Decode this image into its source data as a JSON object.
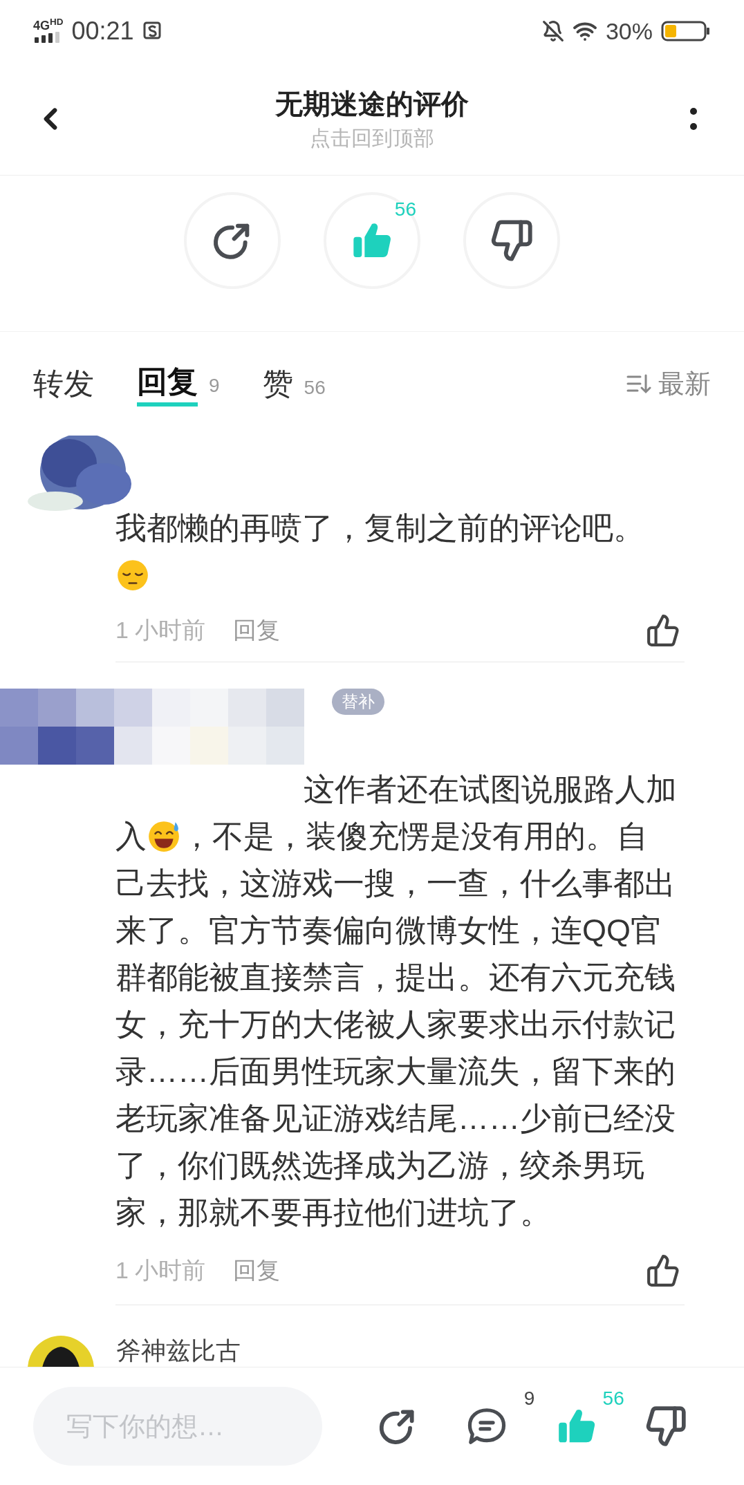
{
  "status_bar": {
    "network": "4G$^{HD}$",
    "time": "00:21",
    "battery": "30%"
  },
  "header": {
    "title": "无期迷途的评价",
    "subtitle": "点击回到顶部"
  },
  "actions": [
    {
      "kind": "share"
    },
    {
      "kind": "like",
      "count": "56",
      "selected": true
    },
    {
      "kind": "dislike",
      "selected": false
    }
  ],
  "tabs": [
    {
      "label": "转发",
      "selected": false
    },
    {
      "label": "回复",
      "count": "9",
      "selected": true
    },
    {
      "label": "赞",
      "count": "56",
      "selected": false
    }
  ],
  "sort": {
    "label": "最新"
  },
  "comments": [
    {
      "avatar": {
        "kind": "scribble"
      },
      "lines": [
        {
          "segments": [
            {
              "kind": "text",
              "text": "我都懒的再喷了，复制之前的评论吧。"
            }
          ]
        },
        {
          "segments": [
            {
              "kind": "pensive"
            }
          ]
        }
      ],
      "time": "1 小时前",
      "reply": "回复"
    },
    {
      "avatar": {
        "kind": "pixelated"
      },
      "badge": "替补",
      "lines": [
        {
          "segments": [
            {
              "kind": "text",
              "text": "这作者还在试图说服路人加"
            }
          ]
        },
        {
          "segments": [
            {
              "kind": "text",
              "text": "入"
            },
            {
              "kind": "sweatsmile"
            },
            {
              "kind": "text",
              "text": "，不是，装傻充愣是没有用的。自"
            }
          ]
        },
        {
          "segments": [
            {
              "kind": "text",
              "text": "己去找，这游戏一搜，一查，什么事都出"
            }
          ]
        },
        {
          "segments": [
            {
              "kind": "text",
              "text": "来了。官方节奏偏向微博女性，连QQ官"
            }
          ]
        },
        {
          "segments": [
            {
              "kind": "text",
              "text": "群都能被直接禁言，提出。还有六元充钱"
            }
          ]
        },
        {
          "segments": [
            {
              "kind": "text",
              "text": "女，充十万的大佬被人家要求出示付款记"
            }
          ]
        },
        {
          "segments": [
            {
              "kind": "text",
              "text": "录……后面男性玩家大量流失，留下来的"
            }
          ]
        },
        {
          "segments": [
            {
              "kind": "text",
              "text": "老玩家准备见证游戏结尾……少前已经没"
            }
          ]
        },
        {
          "segments": [
            {
              "kind": "text",
              "text": "了，你们既然选择成为乙游，绞杀男玩"
            }
          ]
        },
        {
          "segments": [
            {
              "kind": "text",
              "text": "家，那就不要再拉他们进坑了。"
            }
          ]
        }
      ],
      "time": "1 小时前",
      "reply": "回复"
    },
    {
      "avatar": {
        "kind": "figure"
      },
      "name": "斧神兹比古"
    }
  ],
  "composer": {
    "placeholder": "写下你的想…"
  },
  "bottom_actions": [
    {
      "kind": "share"
    },
    {
      "kind": "comment",
      "count": "9"
    },
    {
      "kind": "like",
      "count": "56",
      "selected": true
    },
    {
      "kind": "dislike",
      "selected": false
    }
  ]
}
